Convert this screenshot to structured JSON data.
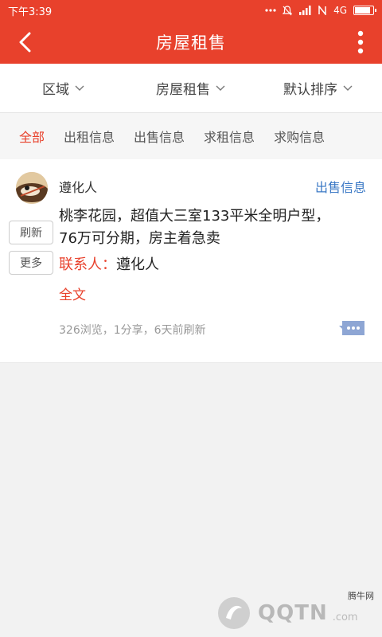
{
  "status_bar": {
    "time": "下午3:39",
    "network": "4G",
    "battery_level": 0.9
  },
  "nav": {
    "title": "房屋租售"
  },
  "filters": [
    {
      "label": "区域"
    },
    {
      "label": "房屋租售"
    },
    {
      "label": "默认排序"
    }
  ],
  "tabs": [
    {
      "label": "全部",
      "active": true
    },
    {
      "label": "出租信息",
      "active": false
    },
    {
      "label": "出售信息",
      "active": false
    },
    {
      "label": "求租信息",
      "active": false
    },
    {
      "label": "求购信息",
      "active": false
    }
  ],
  "post": {
    "author": "遵化人",
    "category": "出售信息",
    "refresh_label": "刷新",
    "more_label": "更多",
    "content_line1": "桃李花园，超值大三室133平米全明户型，",
    "content_line2": "76万可分期，房主着急卖",
    "contact_label": "联系人：",
    "contact_name": "遵化人",
    "fulltext_label": "全文",
    "stats": "326浏览，1分享，6天前刷新"
  },
  "watermark": {
    "brand": "QQTN",
    "domain": ".com",
    "small": "腾牛网"
  },
  "colors": {
    "primary": "#e8412c",
    "link": "#3a78c5",
    "comment_icon": "#8ea6d4"
  }
}
